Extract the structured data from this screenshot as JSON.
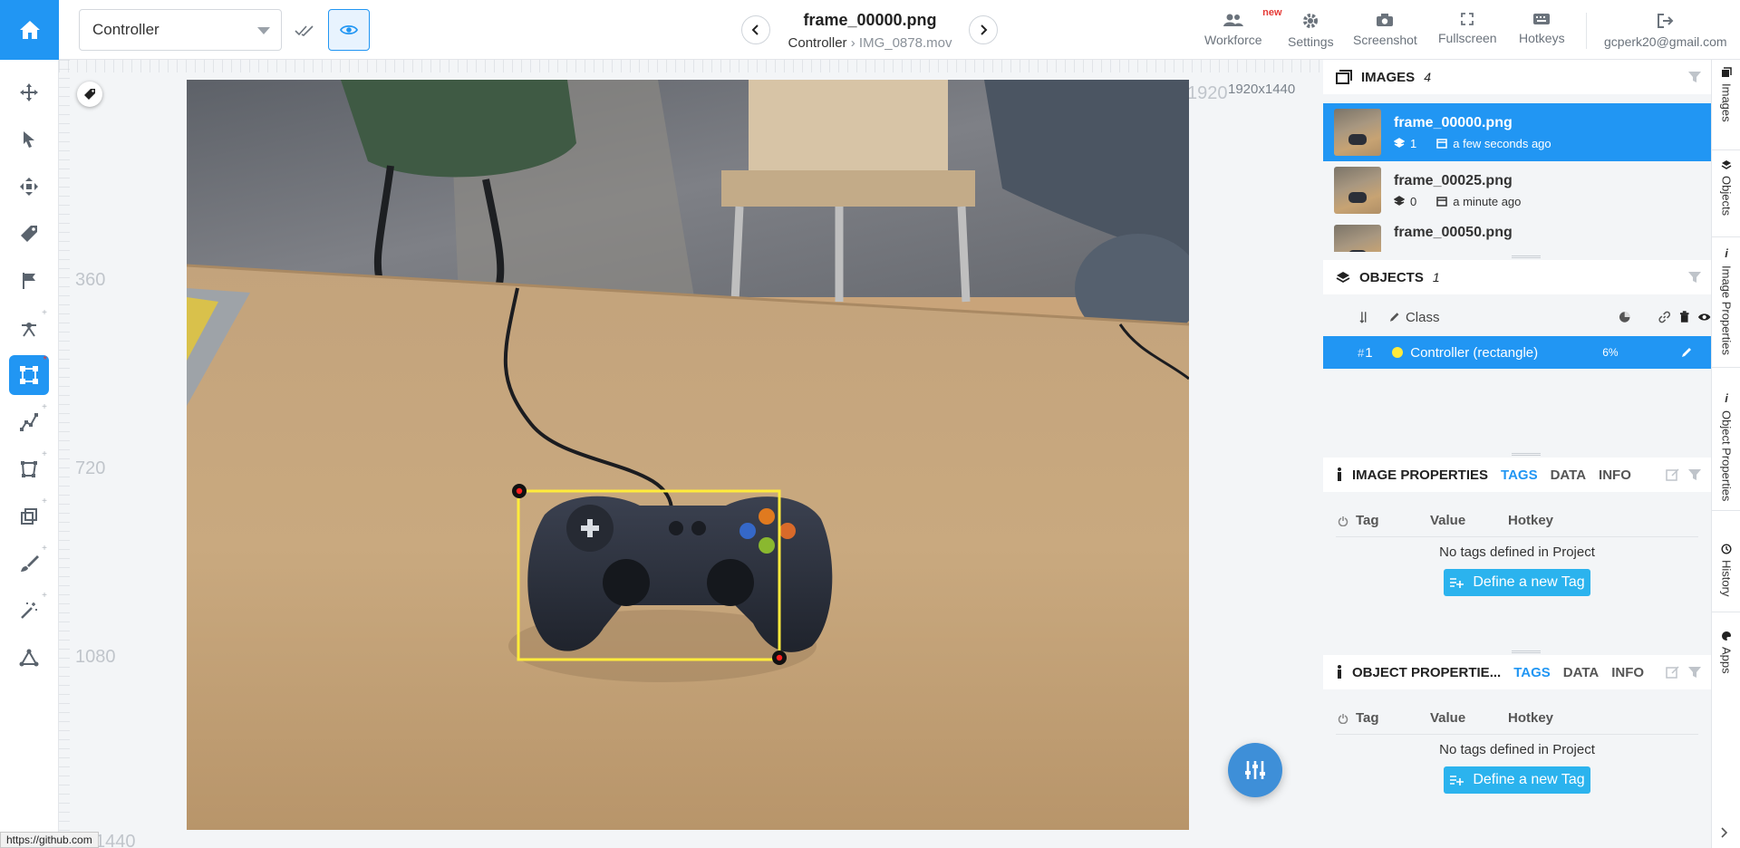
{
  "topbar": {
    "class_select": "Controller",
    "file_title": "frame_00000.png",
    "breadcrumb_class": "Controller",
    "breadcrumb_sep": "›",
    "breadcrumb_video": "IMG_0878.mov",
    "tools": [
      {
        "label": "Workforce",
        "icon": "users-icon",
        "badge": "new"
      },
      {
        "label": "Settings",
        "icon": "gear-icon"
      },
      {
        "label": "Screenshot",
        "icon": "camera-icon"
      },
      {
        "label": "Fullscreen",
        "icon": "fullscreen-icon"
      },
      {
        "label": "Hotkeys",
        "icon": "keyboard-icon"
      }
    ],
    "user_email": "gcperk20@gmail.com"
  },
  "canvas": {
    "image_dimensions": "1920x1440",
    "ruler_top": "1920",
    "ruler_left": [
      "360",
      "720",
      "1080",
      "1440"
    ],
    "annotation_color": "#ffeb3b"
  },
  "status_url": "https://github.com",
  "images_panel": {
    "title": "IMAGES",
    "count": "4",
    "items": [
      {
        "name": "frame_00000.png",
        "objects": "1",
        "time": "a few seconds ago"
      },
      {
        "name": "frame_00025.png",
        "objects": "0",
        "time": "a minute ago"
      },
      {
        "name": "frame_00050.png",
        "objects": "",
        "time": ""
      }
    ]
  },
  "objects_panel": {
    "title": "OBJECTS",
    "count": "1",
    "class_header": "Class",
    "rows": [
      {
        "index": "1",
        "label": "Controller (rectangle)",
        "area": "6%"
      }
    ]
  },
  "image_properties": {
    "title": "IMAGE PROPERTIES",
    "tabs": [
      "TAGS",
      "DATA",
      "INFO"
    ],
    "columns": [
      "Tag",
      "Value",
      "Hotkey"
    ],
    "empty": "No tags defined in Project",
    "define_button": "Define a new Tag"
  },
  "object_properties": {
    "title": "OBJECT PROPERTIE...",
    "tabs": [
      "TAGS",
      "DATA",
      "INFO"
    ],
    "columns": [
      "Tag",
      "Value",
      "Hotkey"
    ],
    "empty": "No tags defined in Project",
    "define_button": "Define a new Tag"
  },
  "vertical_tabs": [
    "Images",
    "Objects",
    "Image Properties",
    "Object Properties",
    "History",
    "Apps"
  ],
  "colors": {
    "accent": "#2196f3",
    "button": "#2bb3ee",
    "annotation": "#ffeb3b"
  }
}
